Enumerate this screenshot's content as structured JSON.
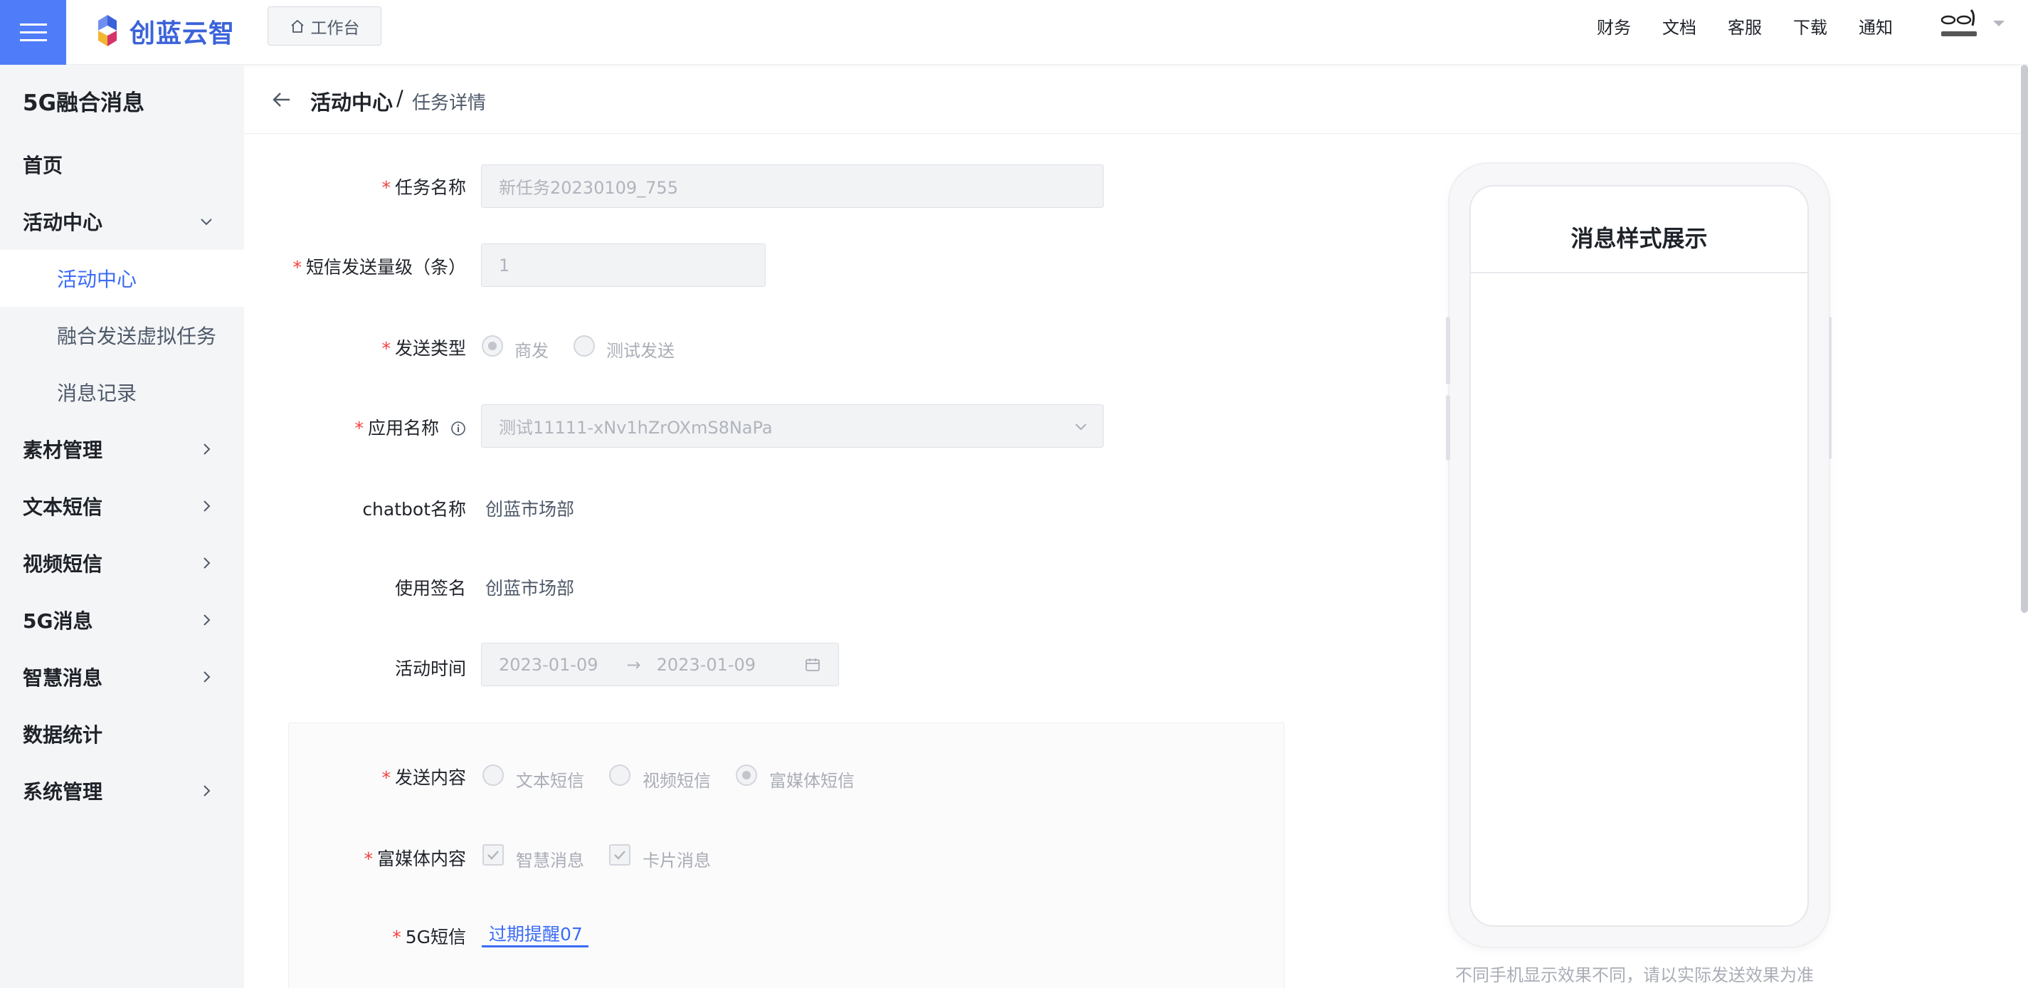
{
  "header": {
    "brand": "创蓝云智",
    "workbench_label": "工作台",
    "nav": [
      "财务",
      "文档",
      "客服",
      "下载",
      "通知"
    ]
  },
  "sidebar": {
    "product_title": "5G融合消息",
    "items": [
      {
        "label": "首页"
      },
      {
        "label": "活动中心"
      },
      {
        "label": "活动中心"
      },
      {
        "label": "融合发送虚拟任务"
      },
      {
        "label": "消息记录"
      },
      {
        "label": "素材管理"
      },
      {
        "label": "文本短信"
      },
      {
        "label": "视频短信"
      },
      {
        "label": "5G消息"
      },
      {
        "label": "智慧消息"
      },
      {
        "label": "数据统计"
      },
      {
        "label": "系统管理"
      }
    ]
  },
  "breadcrumb": {
    "parent": "活动中心",
    "separator": "/",
    "current": "任务详情"
  },
  "form": {
    "task_name": {
      "label": "任务名称",
      "value": "新任务20230109_755"
    },
    "sms_volume": {
      "label": "短信发送量级（条）",
      "value": "1"
    },
    "send_type": {
      "label": "发送类型",
      "options": [
        "商发",
        "测试发送"
      ],
      "selected": "商发"
    },
    "app_name": {
      "label": "应用名称",
      "value": "测试11111-xNv1hZrOXmS8NaPa"
    },
    "chatbot_name": {
      "label": "chatbot名称",
      "value": "创蓝市场部"
    },
    "signature": {
      "label": "使用签名",
      "value": "创蓝市场部"
    },
    "activity_time": {
      "label": "活动时间",
      "start": "2023-01-09",
      "arrow": "→",
      "end": "2023-01-09"
    },
    "send_content": {
      "label": "发送内容",
      "options": [
        "文本短信",
        "视频短信",
        "富媒体短信"
      ],
      "selected": "富媒体短信"
    },
    "rich_content": {
      "label": "富媒体内容",
      "options": [
        "智慧消息",
        "卡片消息"
      ]
    },
    "sms_5g": {
      "label": "5G短信",
      "value": "过期提醒07"
    }
  },
  "preview": {
    "title": "消息样式展示",
    "note": "不同手机显示效果不同，请以实际发送效果为准"
  },
  "colors": {
    "accent": "#4f7df9",
    "link": "#3b6cf6",
    "required": "#f53f3f"
  }
}
